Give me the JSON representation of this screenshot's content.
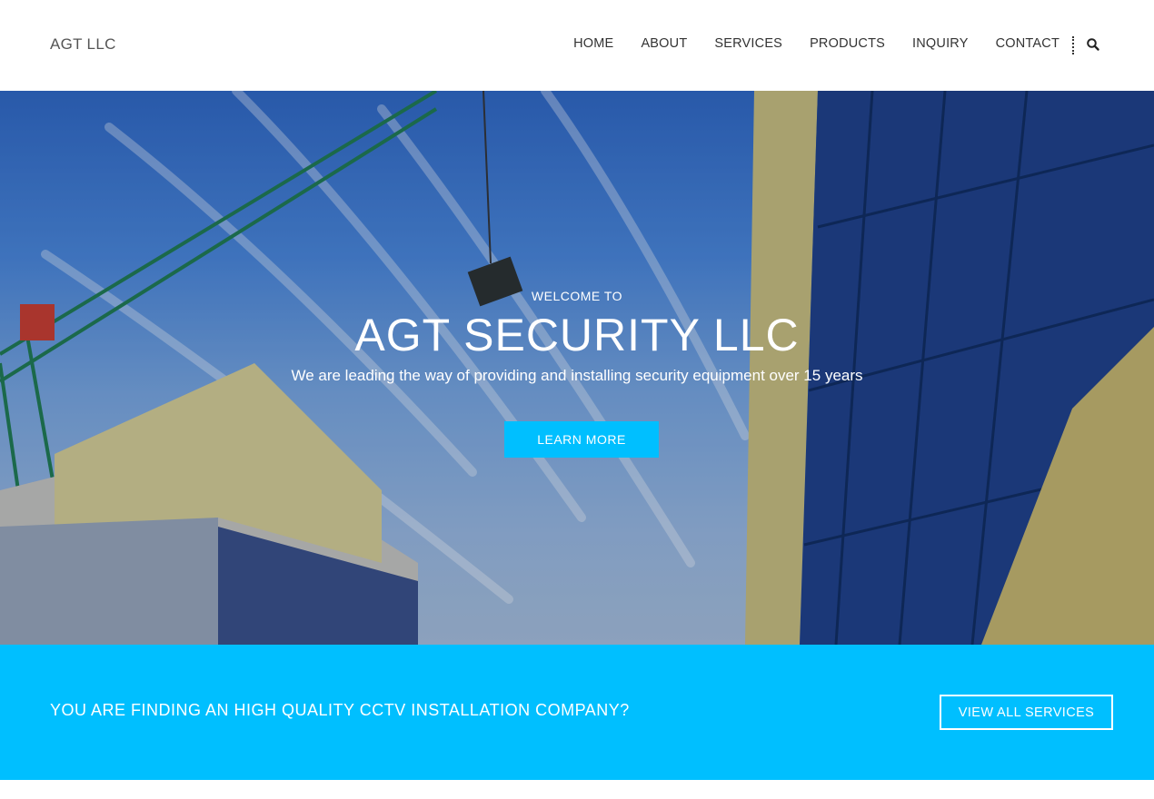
{
  "header": {
    "brand": "AGT LLC",
    "nav": [
      "HOME",
      "ABOUT",
      "SERVICES",
      "PRODUCTS",
      "INQUIRY",
      "CONTACT"
    ],
    "search_icon": "search-icon"
  },
  "hero": {
    "kicker": "WELCOME TO",
    "title": "AGT SECURITY LLC",
    "subtitle": "We are leading the way of providing and installing security equipment over 15 years",
    "button": "LEARN MORE"
  },
  "cta": {
    "text": "YOU ARE FINDING AN HIGH QUALITY CCTV INSTALLATION COMPANY?",
    "button": "VIEW ALL SERVICES"
  },
  "colors": {
    "accent": "#00bfff",
    "nav_text": "#333333",
    "brand_text": "#555555"
  }
}
